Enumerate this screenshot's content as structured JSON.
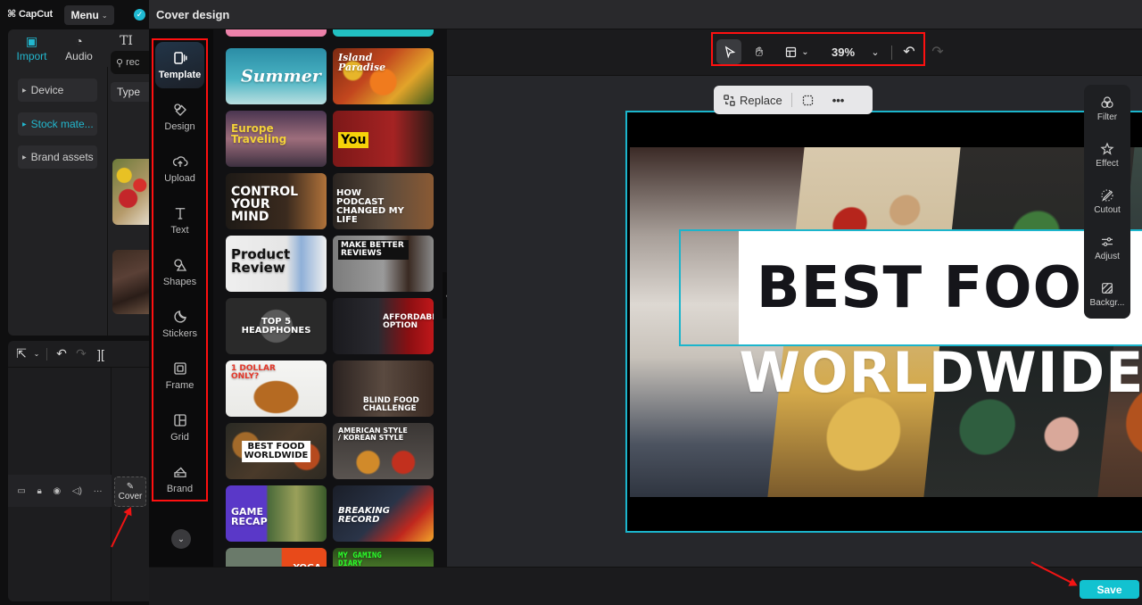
{
  "app": {
    "logo_text": "CapCut",
    "menu_label": "Menu"
  },
  "media_tabs": [
    {
      "label": "Import",
      "icon": "import-icon",
      "active": true
    },
    {
      "label": "Audio",
      "icon": "audio-icon",
      "active": false
    },
    {
      "label": "Text",
      "icon": "text-icon",
      "active": false
    }
  ],
  "media_nav": [
    {
      "label": "Device",
      "active": false
    },
    {
      "label": "Stock mate...",
      "active": true
    },
    {
      "label": "Brand assets",
      "active": false
    }
  ],
  "media_search": {
    "value": "rec"
  },
  "media_type_filter": "Type",
  "timeline": {
    "cover_label": "Cover"
  },
  "modal": {
    "title": "Cover design",
    "tool_rail": [
      {
        "label": "Template",
        "icon": "template-icon",
        "active": true
      },
      {
        "label": "Design",
        "icon": "design-icon",
        "active": false
      },
      {
        "label": "Upload",
        "icon": "upload-icon",
        "active": false
      },
      {
        "label": "Text",
        "icon": "text-icon",
        "active": false
      },
      {
        "label": "Shapes",
        "icon": "shapes-icon",
        "active": false
      },
      {
        "label": "Stickers",
        "icon": "stickers-icon",
        "active": false
      },
      {
        "label": "Frame",
        "icon": "frame-icon",
        "active": false
      },
      {
        "label": "Grid",
        "icon": "grid-icon",
        "active": false
      },
      {
        "label": "Brand",
        "icon": "brand-icon",
        "active": false
      }
    ],
    "templates": [
      {
        "title": "",
        "theme": "pink"
      },
      {
        "title": "",
        "theme": "pool"
      },
      {
        "title": "Summer",
        "theme": "summer"
      },
      {
        "title": "Island Paradise",
        "theme": "island"
      },
      {
        "title": "Europe Traveling",
        "theme": "europe"
      },
      {
        "title": "You",
        "theme": "you"
      },
      {
        "title": "CONTROL YOUR MIND",
        "theme": "mind"
      },
      {
        "title": "HOW PODCAST CHANGED MY LIFE",
        "theme": "podcast"
      },
      {
        "title": "Product Review",
        "theme": "product"
      },
      {
        "title": "MAKE BETTER REVIEWS",
        "theme": "reviews"
      },
      {
        "title": "TOP 5 HEADPHONES",
        "theme": "headphones"
      },
      {
        "title": "AFFORDABLE OPTION",
        "theme": "affordable"
      },
      {
        "title": "1 DOLLAR ONLY?",
        "theme": "burger"
      },
      {
        "title": "BLIND FOOD CHALLENGE",
        "theme": "blind"
      },
      {
        "title": "BEST FOOD WORLDWIDE",
        "theme": "bestfood"
      },
      {
        "title": "AMERICAN STYLE / KOREAN STYLE",
        "theme": "chicken"
      },
      {
        "title": "GAME RECAP",
        "theme": "game"
      },
      {
        "title": "BREAKING RECORD",
        "theme": "hockey"
      },
      {
        "title": "YOGA",
        "theme": "yoga"
      },
      {
        "title": "MY GAMING DIARY",
        "theme": "gaming"
      }
    ],
    "canvas_toolbar": {
      "zoom": "39%"
    },
    "context_bar": {
      "replace_label": "Replace"
    },
    "cover": {
      "line1": "BEST FOOD",
      "line2": "WORLDWIDE"
    },
    "property_rail": [
      {
        "label": "Filter",
        "icon": "filter-icon"
      },
      {
        "label": "Effect",
        "icon": "effect-icon"
      },
      {
        "label": "Cutout",
        "icon": "cutout-icon"
      },
      {
        "label": "Adjust",
        "icon": "adjust-icon"
      },
      {
        "label": "Backgr...",
        "icon": "background-icon"
      }
    ],
    "save_label": "Save"
  },
  "colors": {
    "accent": "#1bb5cc",
    "save_button": "#12c2d0",
    "annotation_red": "#ff1010"
  }
}
